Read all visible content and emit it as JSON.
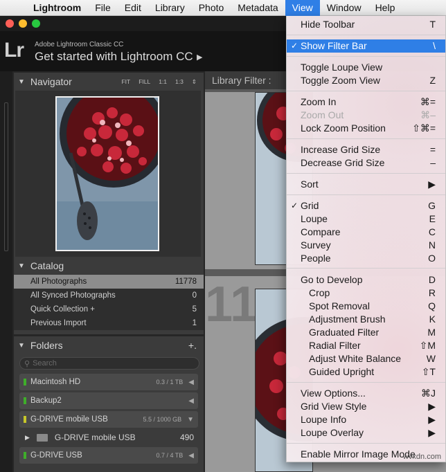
{
  "menubar": {
    "apple_icon": "apple-icon",
    "items": [
      "Lightroom",
      "File",
      "Edit",
      "Library",
      "Photo",
      "Metadata",
      "View",
      "Window",
      "Help"
    ],
    "active": "View"
  },
  "identity": {
    "logo": "Lr",
    "small_text": "Adobe Lightroom Classic CC",
    "big_text": "Get started with Lightroom CC",
    "arrow": "▶"
  },
  "navigator": {
    "title": "Navigator",
    "options": [
      "FIT",
      "FILL",
      "1:1",
      "1:3",
      "⇕"
    ]
  },
  "catalog": {
    "title": "Catalog",
    "rows": [
      {
        "label": "All Photographs",
        "count": "11778"
      },
      {
        "label": "All Synced Photographs",
        "count": "0"
      },
      {
        "label": "Quick Collection +",
        "count": "5"
      },
      {
        "label": "Previous Import",
        "count": "1"
      }
    ]
  },
  "folders": {
    "title": "Folders",
    "add": "+.",
    "search_placeholder": "Search",
    "volumes": [
      {
        "name": "Macintosh HD",
        "capacity": "0.3 / 1 TB",
        "arrow": "◀"
      },
      {
        "name": "Backup2",
        "capacity": "",
        "arrow": "◀"
      },
      {
        "name": "G-DRIVE mobile USB",
        "capacity": "5.5 / 1000 GB",
        "arrow": "▼"
      },
      {
        "name": "G-DRIVE USB",
        "capacity": "0.7 / 4 TB",
        "arrow": "◀"
      }
    ],
    "subfolder": {
      "name": "G-DRIVE mobile USB",
      "count": "490"
    }
  },
  "center": {
    "filter_label": "Library Filter :",
    "cell_number": "11"
  },
  "view_menu": {
    "items": [
      {
        "label": "Hide Toolbar",
        "shortcut": "T"
      },
      {
        "label": "Show Filter Bar",
        "shortcut": "\\",
        "checked": "✓"
      },
      {
        "label": "Toggle Loupe View",
        "shortcut": ""
      },
      {
        "label": "Toggle Zoom View",
        "shortcut": "Z"
      },
      {
        "label": "Zoom In",
        "shortcut": "⌘="
      },
      {
        "label": "Zoom Out",
        "shortcut": "⌘–"
      },
      {
        "label": "Lock Zoom Position",
        "shortcut": "⇧⌘="
      },
      {
        "label": "Increase Grid Size",
        "shortcut": "="
      },
      {
        "label": "Decrease Grid Size",
        "shortcut": "–"
      },
      {
        "label": "Sort",
        "shortcut": "▶"
      },
      {
        "label": "Grid",
        "shortcut": "G",
        "checked": "✓"
      },
      {
        "label": "Loupe",
        "shortcut": "E"
      },
      {
        "label": "Compare",
        "shortcut": "C"
      },
      {
        "label": "Survey",
        "shortcut": "N"
      },
      {
        "label": "People",
        "shortcut": "O"
      },
      {
        "label": "Go to Develop",
        "shortcut": "D"
      },
      {
        "label": "Crop",
        "shortcut": "R"
      },
      {
        "label": "Spot Removal",
        "shortcut": "Q"
      },
      {
        "label": "Adjustment Brush",
        "shortcut": "K"
      },
      {
        "label": "Graduated Filter",
        "shortcut": "M"
      },
      {
        "label": "Radial Filter",
        "shortcut": "⇧M"
      },
      {
        "label": "Adjust White Balance",
        "shortcut": "W"
      },
      {
        "label": "Guided Upright",
        "shortcut": "⇧T"
      },
      {
        "label": "View Options...",
        "shortcut": "⌘J"
      },
      {
        "label": "Grid View Style",
        "shortcut": "▶"
      },
      {
        "label": "Loupe Info",
        "shortcut": "▶"
      },
      {
        "label": "Loupe Overlay",
        "shortcut": "▶"
      },
      {
        "label": "Enable Mirror Image Mode",
        "shortcut": ""
      }
    ]
  },
  "watermark": "wvxdn.com",
  "colors": {
    "menu_highlight": "#2f7fe6",
    "panel": "#3b3b3b",
    "selected_row": "#8d8d8d"
  }
}
